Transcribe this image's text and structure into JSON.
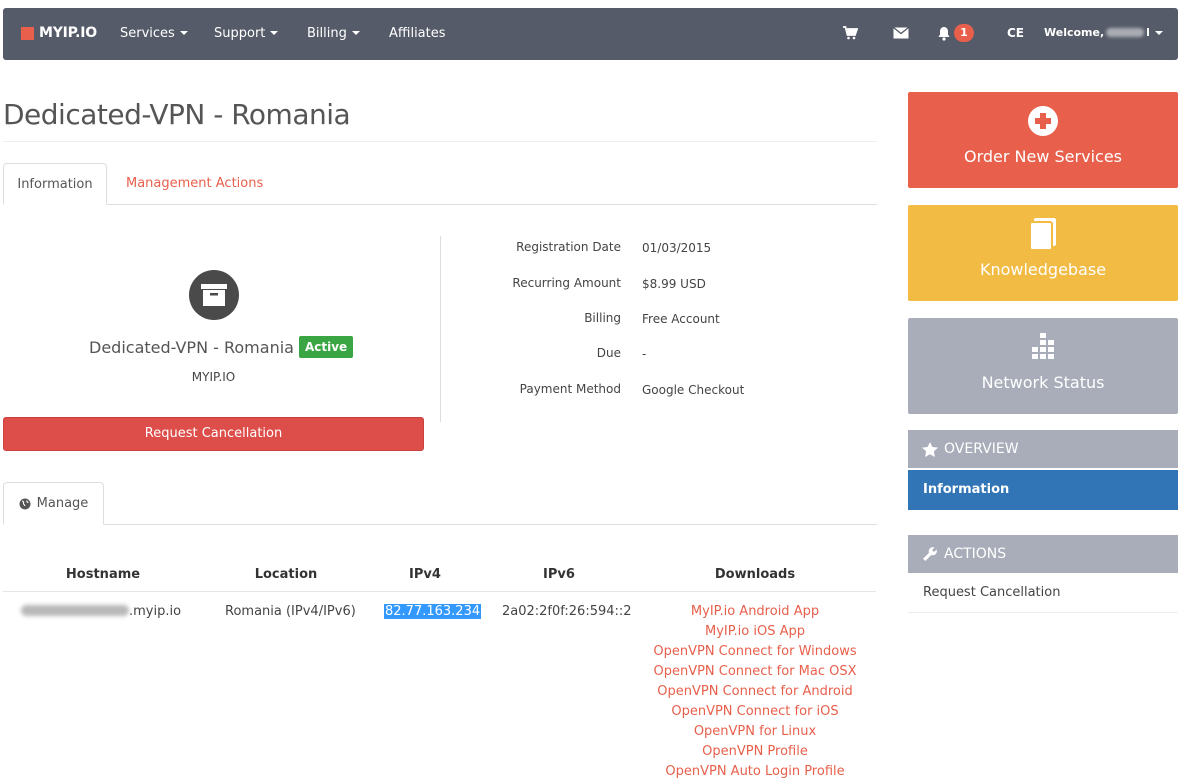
{
  "navbar": {
    "brand": "MYIP.IO",
    "menu": [
      {
        "label": "Services"
      },
      {
        "label": "Support"
      },
      {
        "label": "Billing"
      },
      {
        "label": "Affiliates"
      }
    ],
    "notification_count": "1",
    "language": "CE",
    "welcome_prefix": "Welcome,",
    "welcome_suffix": "l",
    "icons": [
      "cart-icon",
      "envelope-icon",
      "bell-icon",
      "caret-down-icon"
    ]
  },
  "page": {
    "title": "Dedicated-VPN - Romania"
  },
  "tabs": {
    "information": "Information",
    "management": "Management Actions"
  },
  "product": {
    "name": "Dedicated-VPN - Romania",
    "status": "Active",
    "company": "MYIP.IO",
    "cancel_label": "Request Cancellation"
  },
  "details": [
    {
      "label": "Registration Date",
      "value": "01/03/2015"
    },
    {
      "label": "Recurring Amount",
      "value": "$8.99 USD"
    },
    {
      "label": "Billing",
      "value": "Free Account"
    },
    {
      "label": "Due",
      "value": "-"
    },
    {
      "label": "Payment Method",
      "value": "Google Checkout"
    }
  ],
  "manage_tab": {
    "label": "Manage"
  },
  "table": {
    "headers": [
      "Hostname",
      "Location",
      "IPv4",
      "IPv6",
      "Downloads"
    ],
    "row": {
      "hostname_suffix": ".myip.io",
      "location": "Romania (IPv4/IPv6)",
      "ipv4": "82.77.163.234",
      "ipv6": "2a02:2f0f:26:594::2"
    },
    "downloads": [
      "MyIP.io Android App",
      "MyIP.io iOS App",
      "OpenVPN Connect for Windows",
      "OpenVPN Connect for Mac OSX",
      "OpenVPN Connect for Android",
      "OpenVPN Connect for iOS",
      "OpenVPN for Linux",
      "OpenVPN Profile",
      "OpenVPN Auto Login Profile"
    ]
  },
  "sidebar": {
    "tiles": [
      {
        "label": "Order New Services",
        "color": "#e8604c"
      },
      {
        "label": "Knowledgebase",
        "color": "#f1bb44"
      },
      {
        "label": "Network Status",
        "color": "#a8adb9"
      }
    ],
    "overview": {
      "title": "OVERVIEW",
      "item": "Information"
    },
    "actions": {
      "title": "ACTIONS",
      "item": "Request Cancellation"
    }
  }
}
